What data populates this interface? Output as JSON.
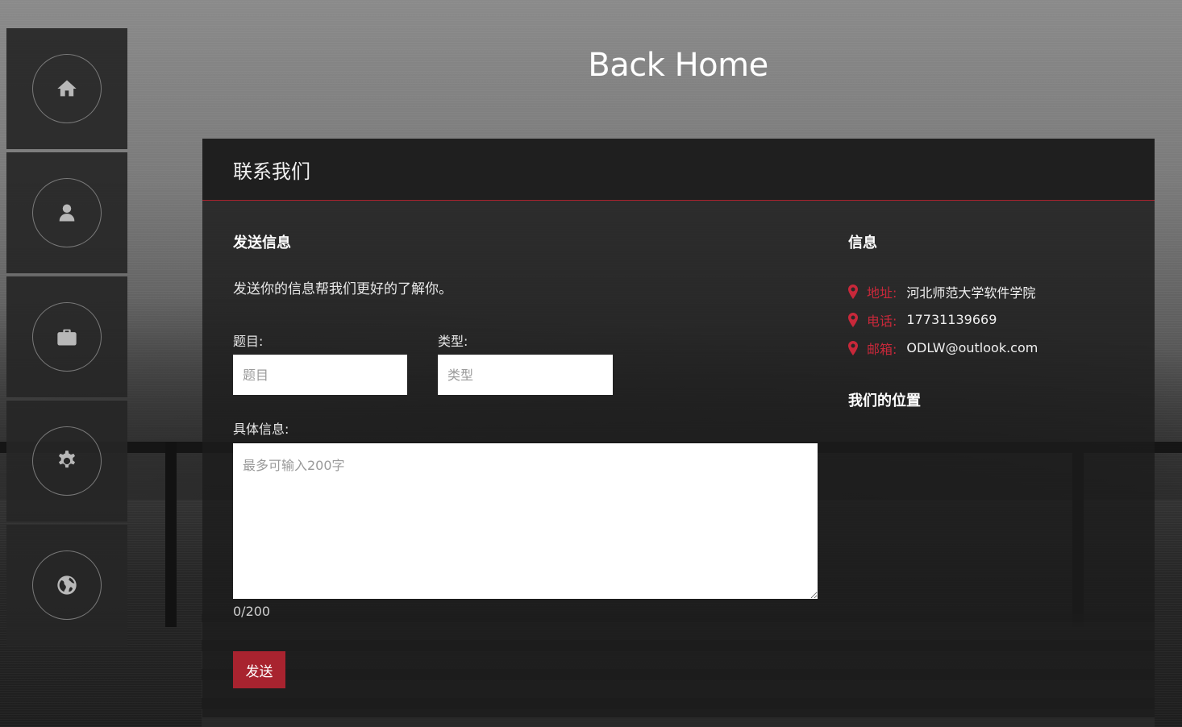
{
  "page": {
    "title": "Back Home"
  },
  "sidebar": {
    "items": [
      {
        "icon": "home-icon"
      },
      {
        "icon": "user-icon"
      },
      {
        "icon": "briefcase-icon"
      },
      {
        "icon": "gear-icon"
      },
      {
        "icon": "globe-icon"
      }
    ]
  },
  "panel": {
    "header": "联系我们",
    "send_section": {
      "title": "发送信息",
      "description": "发送你的信息帮我们更好的了解你。",
      "subject_label": "题目:",
      "subject_placeholder": "题目",
      "type_label": "类型:",
      "type_placeholder": "类型",
      "detail_label": "具体信息:",
      "detail_placeholder": "最多可输入200字",
      "counter": "0/200",
      "send_label": "发送"
    },
    "info_section": {
      "title": "信息",
      "rows": [
        {
          "key": "地址:",
          "value": "河北师范大学软件学院"
        },
        {
          "key": "电话:",
          "value": "17731139669"
        },
        {
          "key": "邮箱:",
          "value": "ODLW@outlook.com"
        }
      ],
      "location_title": "我们的位置"
    }
  },
  "colors": {
    "accent": "#a8232f",
    "panel_bg": "#1c1c1c"
  }
}
